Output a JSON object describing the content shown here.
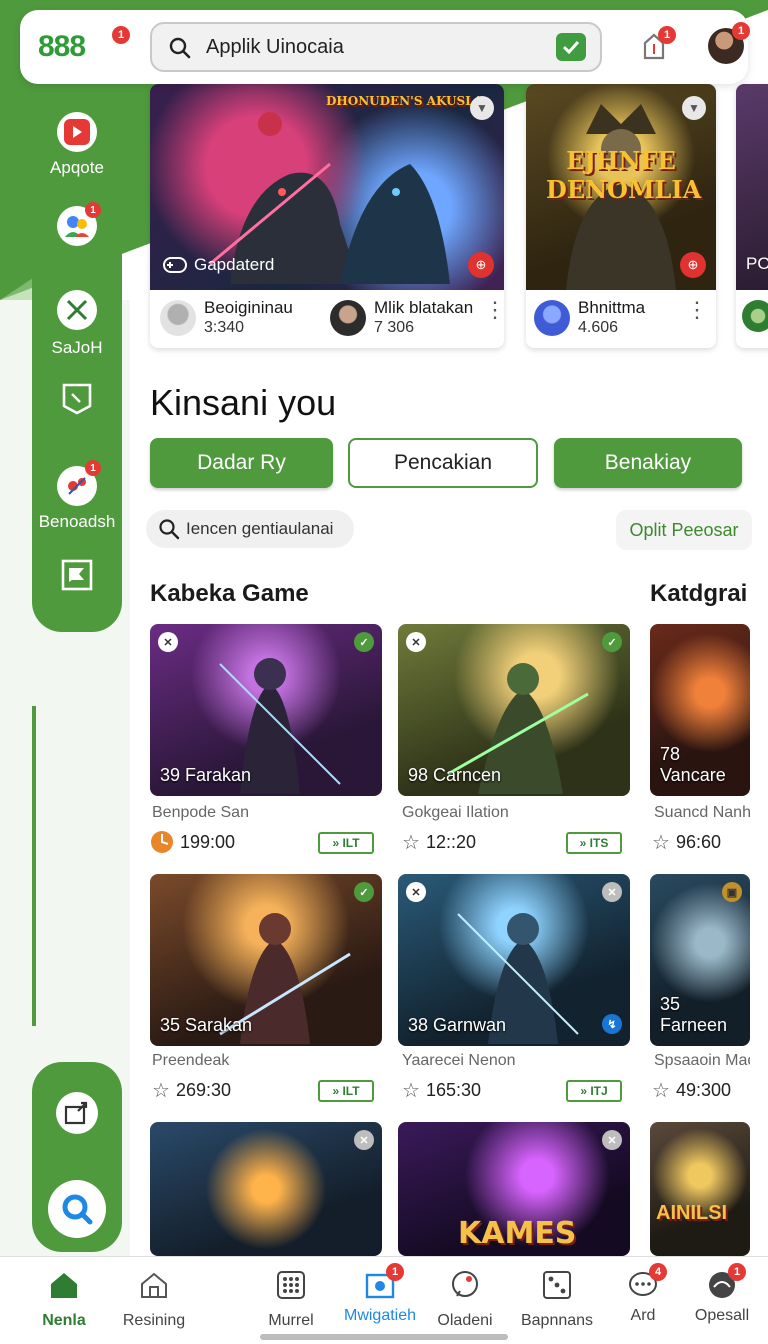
{
  "app": {
    "logo_text": "888",
    "logo_badge": "1"
  },
  "search": {
    "placeholder": "Applik Uinocaia",
    "icon": "search-icon",
    "verify_icon": "check-icon"
  },
  "header": {
    "bell_icon": "notification-icon",
    "bell_badge": "1",
    "avatar_badge": "1"
  },
  "rail": {
    "items": [
      {
        "label": "Apqote",
        "icon": "play-icon"
      },
      {
        "label": "",
        "icon": "people-icon",
        "badge": "1"
      },
      {
        "label": "SaJoH",
        "icon": "crossed-swords-icon"
      },
      {
        "label": "",
        "icon": "bookmark-icon"
      },
      {
        "label": "Benoadsh",
        "icon": "bug-icon",
        "badge": "1"
      },
      {
        "label": "",
        "icon": "flag-icon"
      }
    ],
    "lower_items": [
      {
        "icon": "share-icon"
      },
      {
        "icon": "search-icon"
      }
    ]
  },
  "featured": [
    {
      "art_title": "DHONUDEN'S AKUSLA",
      "caption": "Gapdaterd",
      "players": [
        {
          "name": "Beoigininau",
          "count": "3:340"
        },
        {
          "name": "Mlik blatakan",
          "count": "7 306"
        }
      ]
    },
    {
      "art_title": "EJHNFE DENOMLIA",
      "caption": "",
      "players": [
        {
          "name": "Bhnittma",
          "count": "4.606"
        }
      ]
    },
    {
      "art_title": "",
      "caption": "PO",
      "players": []
    }
  ],
  "main": {
    "heading": "Kinsani you",
    "buttons": [
      "Dadar Ry",
      "Pencakian",
      "Benakiay"
    ],
    "subsearch": "Iencen gentiaulanai",
    "optlink": "Oplit Peeosar",
    "section_left": "Kabeka Game",
    "section_right": "Katdgrai"
  },
  "games": [
    {
      "title": "39  Farakan",
      "sub": "Benpode San",
      "rating": "199:00",
      "tag": "» ILT",
      "rating_icon": "fire-icon"
    },
    {
      "title": "98  Carncen",
      "sub": "Gokgeai Ilation",
      "rating": "12::20",
      "tag": "» ITS",
      "rating_icon": "star-icon"
    },
    {
      "title": "78  Vancare",
      "sub": "Suancd Nanho",
      "rating": "96:60",
      "tag": "",
      "rating_icon": "star-icon"
    },
    {
      "title": "35  Sarakan",
      "sub": "Preendeak",
      "rating": "269:30",
      "tag": "» ILT",
      "rating_icon": "star-icon"
    },
    {
      "title": "38  Garnwan",
      "sub": "Yaarecei Nenon",
      "rating": "165:30",
      "tag": "» ITJ",
      "rating_icon": "star-icon"
    },
    {
      "title": "35  Farneen",
      "sub": "Spsaaoin Mao",
      "rating": "49:300",
      "tag": "",
      "rating_icon": "star-icon"
    },
    {
      "title": "",
      "sub": "",
      "rating": "",
      "tag": ""
    },
    {
      "title": "KAMES",
      "sub": "",
      "rating": "",
      "tag": ""
    },
    {
      "title": "AINILSI",
      "sub": "",
      "rating": "",
      "tag": ""
    }
  ],
  "bottomnav": [
    {
      "label": "Nenla",
      "icon": "home-icon",
      "active": true
    },
    {
      "label": "Resining",
      "icon": "house-outline-icon"
    },
    {
      "label": "Murrel",
      "icon": "grid-icon"
    },
    {
      "label": "Mwigatieh",
      "icon": "image-icon",
      "badge": "1"
    },
    {
      "label": "Oladeni",
      "icon": "chat-icon"
    },
    {
      "label": "Bapnnans",
      "icon": "dice-icon"
    },
    {
      "label": "Ard",
      "icon": "message-icon",
      "badge": "4"
    },
    {
      "label": "Opesall",
      "icon": "globe-icon",
      "badge": "1"
    }
  ],
  "colors": {
    "brand_green": "#4f9a3d",
    "badge_red": "#e53935",
    "link_green": "#3d8a2d"
  }
}
